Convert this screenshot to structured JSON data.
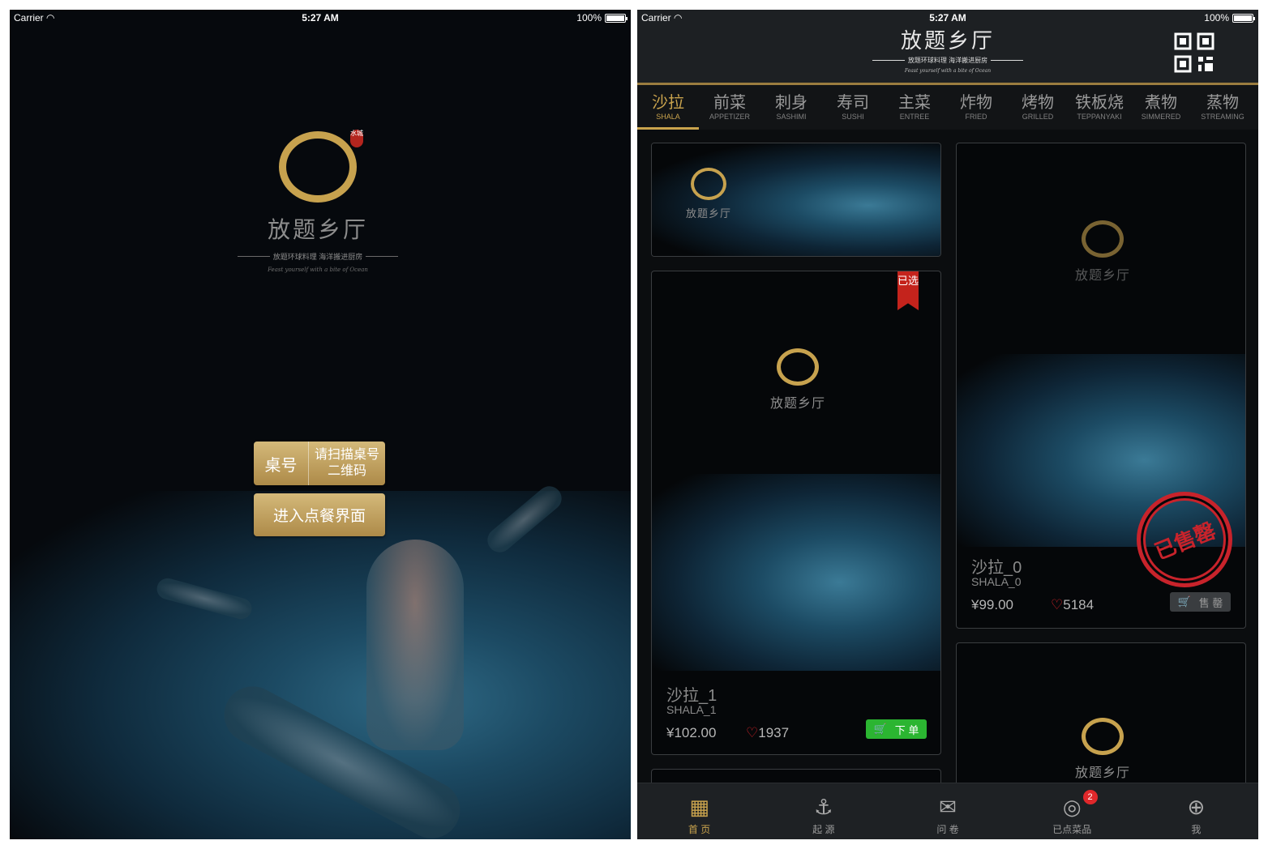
{
  "status_bar": {
    "carrier": "Carrier",
    "time": "5:27 AM",
    "battery": "100%"
  },
  "brand": {
    "name": "放题乡厅",
    "slogan": "放题环球料理  海洋搬进厨房",
    "tagline": "Feast yourself with a bite of Ocean",
    "seal": "水城"
  },
  "login": {
    "table_label": "桌号",
    "scan_prompt_line1": "请扫描桌号",
    "scan_prompt_line2": "二维码",
    "enter_button": "进入点餐界面"
  },
  "categories": [
    {
      "cn": "沙拉",
      "en": "SHALA",
      "selected": true
    },
    {
      "cn": "前菜",
      "en": "APPETIZER"
    },
    {
      "cn": "刺身",
      "en": "SASHIMI"
    },
    {
      "cn": "寿司",
      "en": "SUSHI"
    },
    {
      "cn": "主菜",
      "en": "ENTREE"
    },
    {
      "cn": "炸物",
      "en": "FRIED"
    },
    {
      "cn": "烤物",
      "en": "GRILLED"
    },
    {
      "cn": "铁板烧",
      "en": "TEPPANYAKI"
    },
    {
      "cn": "煮物",
      "en": "SIMMERED"
    },
    {
      "cn": "蒸物",
      "en": "STREAMING"
    }
  ],
  "dishes": [
    {
      "name": "沙拉_1",
      "en": "SHALA_1",
      "price": "¥102.00",
      "likes": "1937",
      "action": "下 单",
      "ribbon": "已选"
    },
    {
      "name": "沙拉_0",
      "en": "SHALA_0",
      "price": "¥99.00",
      "likes": "5184",
      "action": "售 罄",
      "stamp": "已售罄"
    }
  ],
  "tab_bar": [
    {
      "label": "首 页",
      "icon": "home-icon",
      "selected": true
    },
    {
      "label": "起 源",
      "icon": "anchor-icon"
    },
    {
      "label": "问 卷",
      "icon": "mail-icon"
    },
    {
      "label": "已点菜品",
      "icon": "dish-icon",
      "badge": "2"
    },
    {
      "label": "我",
      "icon": "slippers-icon"
    }
  ],
  "colors": {
    "gold": "#c9a34d",
    "red": "#c8232b",
    "green": "#29b530"
  }
}
